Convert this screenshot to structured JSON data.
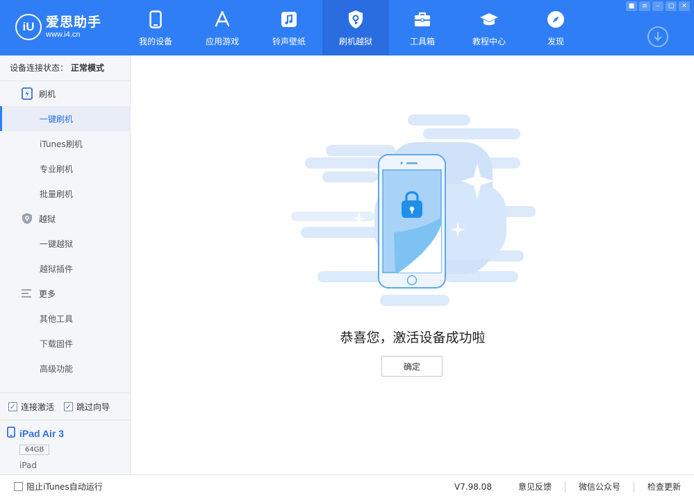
{
  "app": {
    "logo_mark": "iU",
    "logo_title": "爱思助手",
    "logo_url": "www.i4.cn"
  },
  "nav": [
    {
      "label": "我的设备",
      "icon": "phone-icon"
    },
    {
      "label": "应用游戏",
      "icon": "app-store-icon"
    },
    {
      "label": "铃声壁纸",
      "icon": "music-icon"
    },
    {
      "label": "刷机越狱",
      "icon": "shield-key-icon",
      "active": true
    },
    {
      "label": "工具箱",
      "icon": "toolbox-icon"
    },
    {
      "label": "教程中心",
      "icon": "graduation-cap-icon"
    },
    {
      "label": "发现",
      "icon": "compass-icon"
    }
  ],
  "window_controls": [
    "shirt-icon",
    "menu-icon",
    "minimize-icon",
    "maximize-icon",
    "close-icon"
  ],
  "sidebar": {
    "status_label": "设备连接状态：",
    "status_value": "正常模式",
    "groups": [
      {
        "label": "刷机",
        "icon": "flash-phone-icon",
        "items": [
          "一键刷机",
          "iTunes刷机",
          "专业刷机",
          "批量刷机"
        ]
      },
      {
        "label": "越狱",
        "icon": "jailbreak-shield-icon",
        "items": [
          "一键越狱",
          "越狱插件"
        ]
      },
      {
        "label": "更多",
        "icon": "list-lines-icon",
        "items": [
          "其他工具",
          "下载固件",
          "高级功能"
        ]
      }
    ],
    "selected_item": "一键刷机",
    "checks": [
      {
        "label": "连接激活",
        "checked": true
      },
      {
        "label": "跳过向导",
        "checked": true
      }
    ],
    "device": {
      "name": "iPad Air 3",
      "capacity": "64GB",
      "type": "iPad"
    }
  },
  "main": {
    "message": "恭喜您，激活设备成功啦",
    "confirm_label": "确定"
  },
  "footer": {
    "block_itunes_label": "阻止iTunes自动运行",
    "block_itunes_checked": false,
    "version": "V7.98.08",
    "links": [
      "意见反馈",
      "微信公众号",
      "检查更新"
    ]
  },
  "colors": {
    "header_blue": "#2f7ef6",
    "active_nav": "#2a6de0",
    "selected_text": "#2f6fe0"
  }
}
